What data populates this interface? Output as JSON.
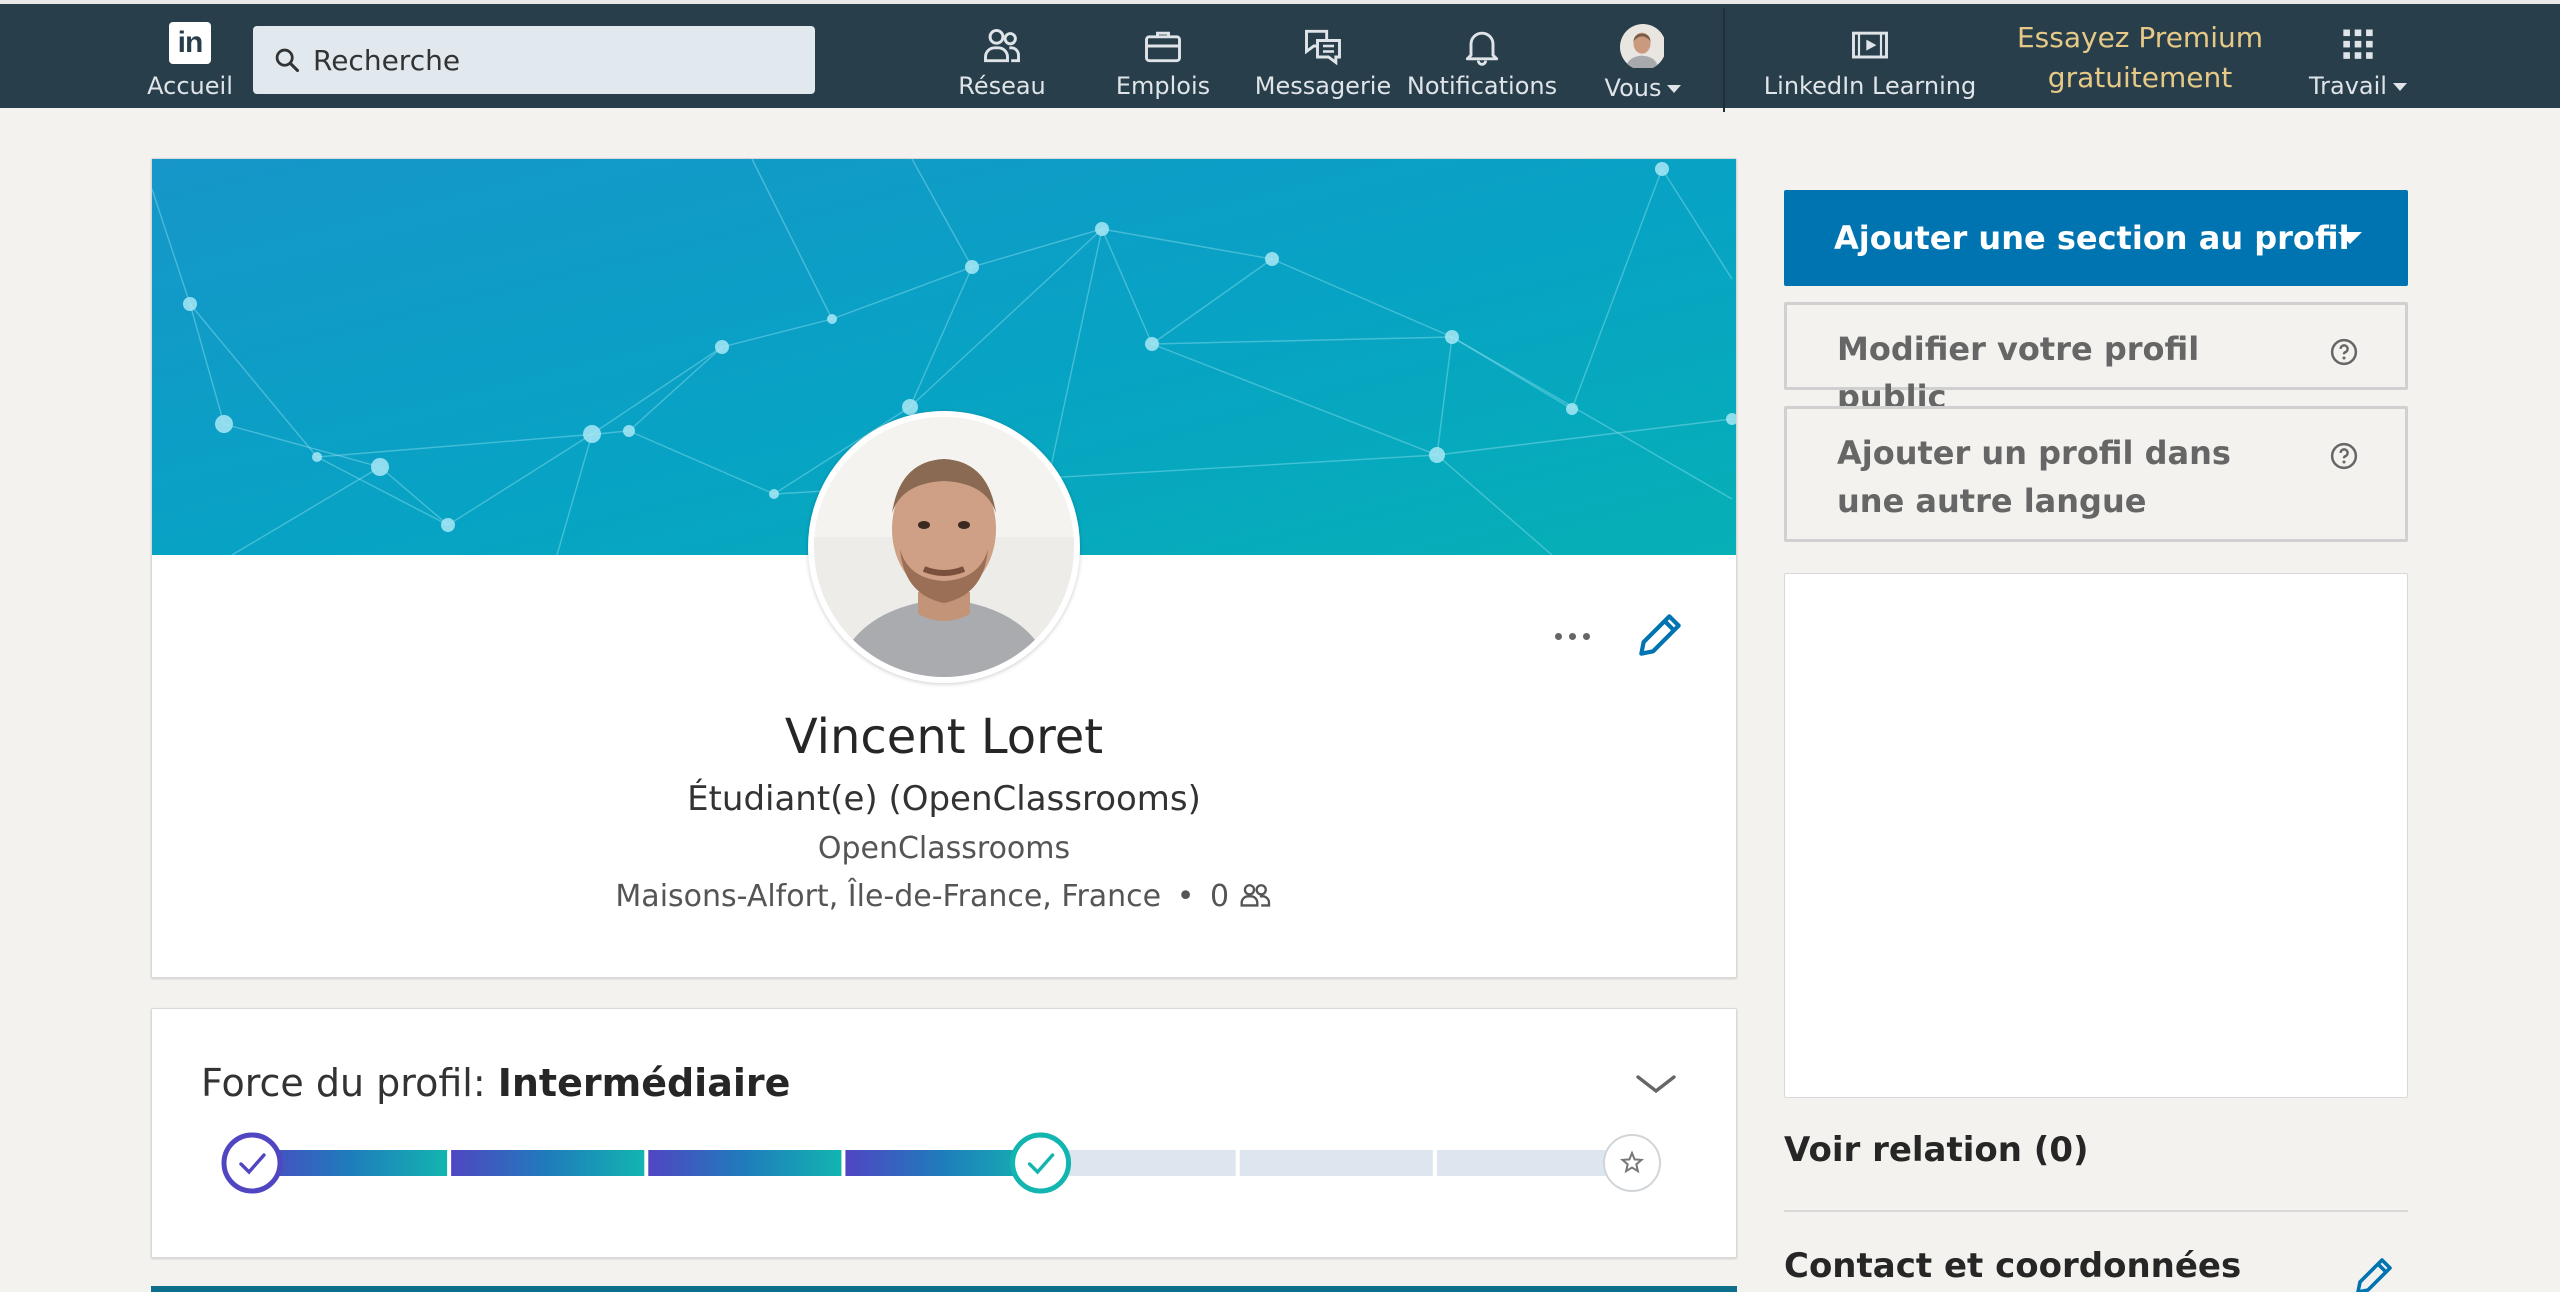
{
  "nav": {
    "home_label": "Accueil",
    "search_placeholder": "Recherche",
    "items": [
      {
        "label": "Réseau",
        "icon": "network-icon"
      },
      {
        "label": "Emplois",
        "icon": "briefcase-icon"
      },
      {
        "label": "Messagerie",
        "icon": "messaging-icon"
      },
      {
        "label": "Notifications",
        "icon": "bell-icon"
      },
      {
        "label": "Vous",
        "icon": "avatar"
      }
    ],
    "learning_label": "LinkedIn Learning",
    "premium_line1": "Essayez Premium",
    "premium_line2": "gratuitement",
    "work_label": "Travail",
    "colors": {
      "bar": "#283e4a",
      "premium": "#e6c887"
    }
  },
  "profile": {
    "name": "Vincent Loret",
    "headline": "Étudiant(e) (OpenClassrooms)",
    "company": "OpenClassrooms",
    "location": "Maisons-Alfort, Île-de-France, France",
    "separator": "•",
    "connections_count": "0"
  },
  "strength": {
    "label": "Force du profil:",
    "level": "Intermédiaire",
    "completed_steps": 4,
    "total_steps": 7
  },
  "rail": {
    "add_section_label": "Ajouter une section au profil",
    "edit_public_profile_label": "Modifier votre profil public",
    "add_language_profile_label": "Ajouter un profil dans une autre langue",
    "connections_label": "Voir relation (0)",
    "contact_label": "Contact et coordonnées",
    "accent": "#0073b1"
  }
}
